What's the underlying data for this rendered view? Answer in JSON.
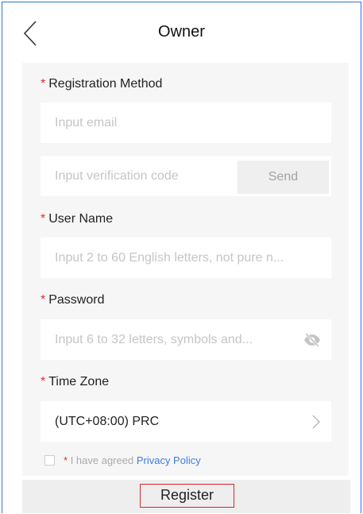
{
  "header": {
    "title": "Owner",
    "back_icon": "chevron-left-icon"
  },
  "form": {
    "registration_method": {
      "required_mark": "*",
      "label": "Registration Method",
      "email_placeholder": "Input email",
      "code_placeholder": "Input verification code",
      "send_label": "Send"
    },
    "user_name": {
      "required_mark": "*",
      "label": "User Name",
      "placeholder": "Input 2 to 60 English letters, not pure n..."
    },
    "password": {
      "required_mark": "*",
      "label": "Password",
      "placeholder": "Input 6 to 32 letters, symbols and...",
      "toggle_icon": "eye-hidden-icon"
    },
    "time_zone": {
      "required_mark": "*",
      "label": "Time Zone",
      "value": "(UTC+08:00) PRC",
      "chevron_icon": "chevron-right-icon"
    },
    "agreement": {
      "checked": false,
      "required_mark": "*",
      "text": "I have agreed",
      "link_text": "Privacy Policy"
    }
  },
  "footer": {
    "register_label": "Register"
  },
  "colors": {
    "accent_blue": "#3b7de0",
    "required_red": "#e23030",
    "frame_blue": "#2b74d6",
    "highlight_red": "#d8262c",
    "panel_bg": "#f6f6f6"
  }
}
